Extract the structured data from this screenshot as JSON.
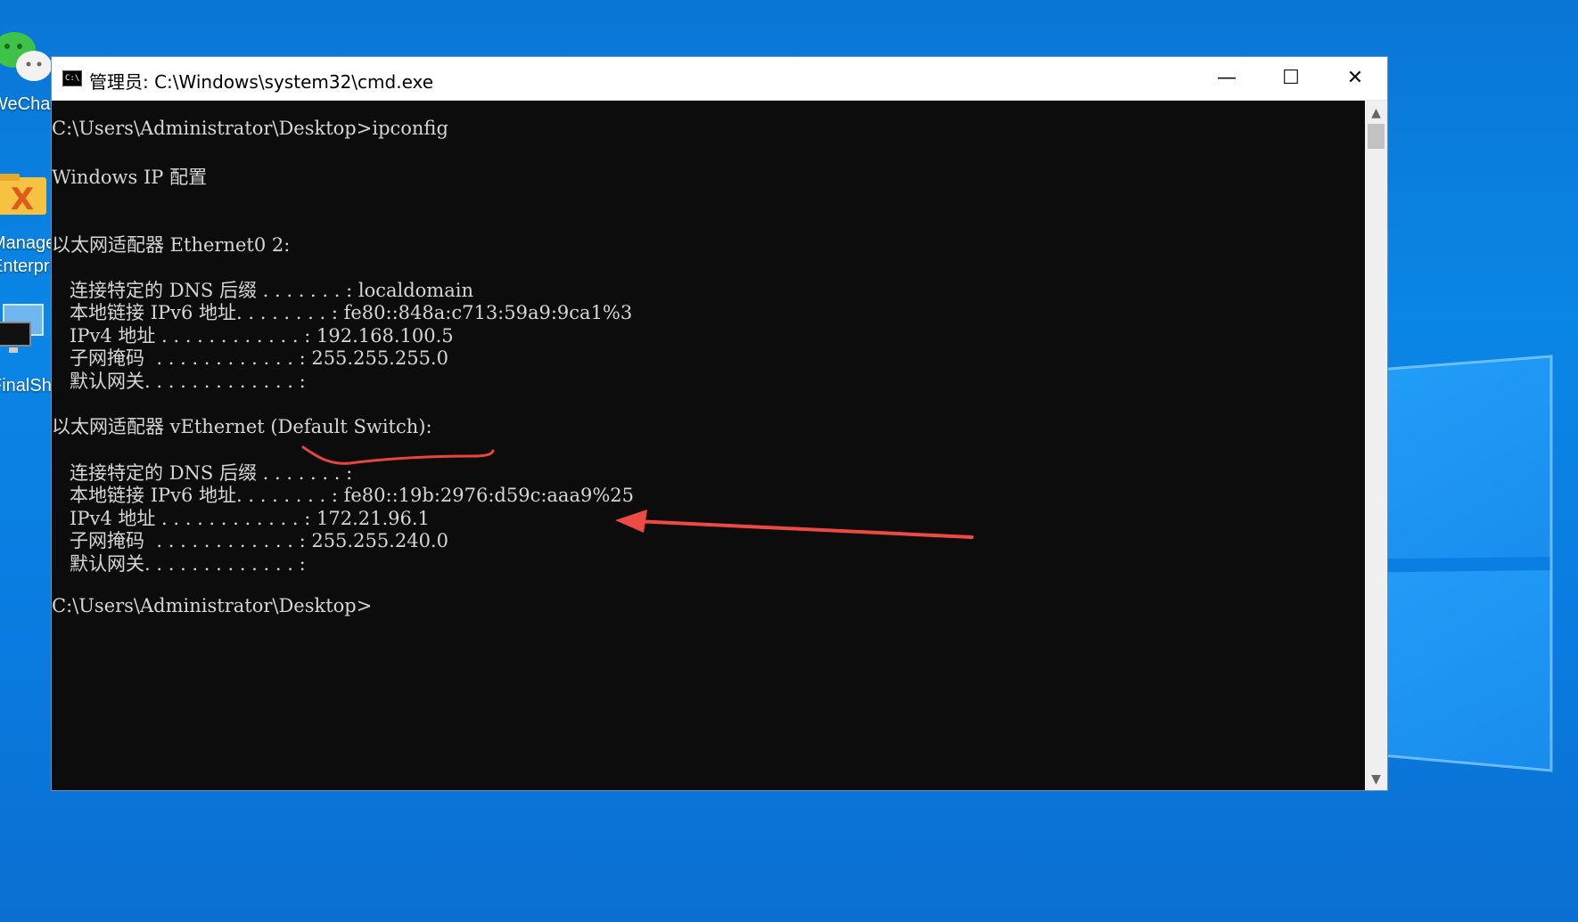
{
  "desktop": {
    "icons": [
      {
        "label": "WeChat",
        "icon": "wechat-icon"
      },
      {
        "label": "Manage Enterprise",
        "icon": "folder-x-icon"
      },
      {
        "label": "FinalShell",
        "icon": "monitor-icon"
      }
    ]
  },
  "window": {
    "title": "管理员: C:\\Windows\\system32\\cmd.exe",
    "app_icon_text": "C:\\",
    "controls": {
      "minimize": "—",
      "maximize": "☐",
      "close": "✕"
    }
  },
  "console": {
    "lines": [
      "C:\\Users\\Administrator\\Desktop>ipconfig",
      "Windows IP 配置",
      "以太网适配器 Ethernet0 2:",
      "   连接特定的 DNS 后缀 . . . . . . . : localdomain",
      "   本地链接 IPv6 地址. . . . . . . . : fe80::848a:c713:59a9:9ca1%3",
      "   IPv4 地址 . . . . . . . . . . . . : 192.168.100.5",
      "   子网掩码  . . . . . . . . . . . . : 255.255.255.0",
      "   默认网关. . . . . . . . . . . . . :",
      "以太网适配器 vEthernet (Default Switch):",
      "   连接特定的 DNS 后缀 . . . . . . . :",
      "   本地链接 IPv6 地址. . . . . . . . : fe80::19b:2976:d59c:aaa9%25",
      "   IPv4 地址 . . . . . . . . . . . . : 172.21.96.1",
      "   子网掩码  . . . . . . . . . . . . : 255.255.240.0",
      "   默认网关. . . . . . . . . . . . . :",
      "C:\\Users\\Administrator\\Desktop>"
    ]
  },
  "annotations": {
    "underline_color": "#e8453c",
    "arrow_color": "#ee4a44"
  }
}
